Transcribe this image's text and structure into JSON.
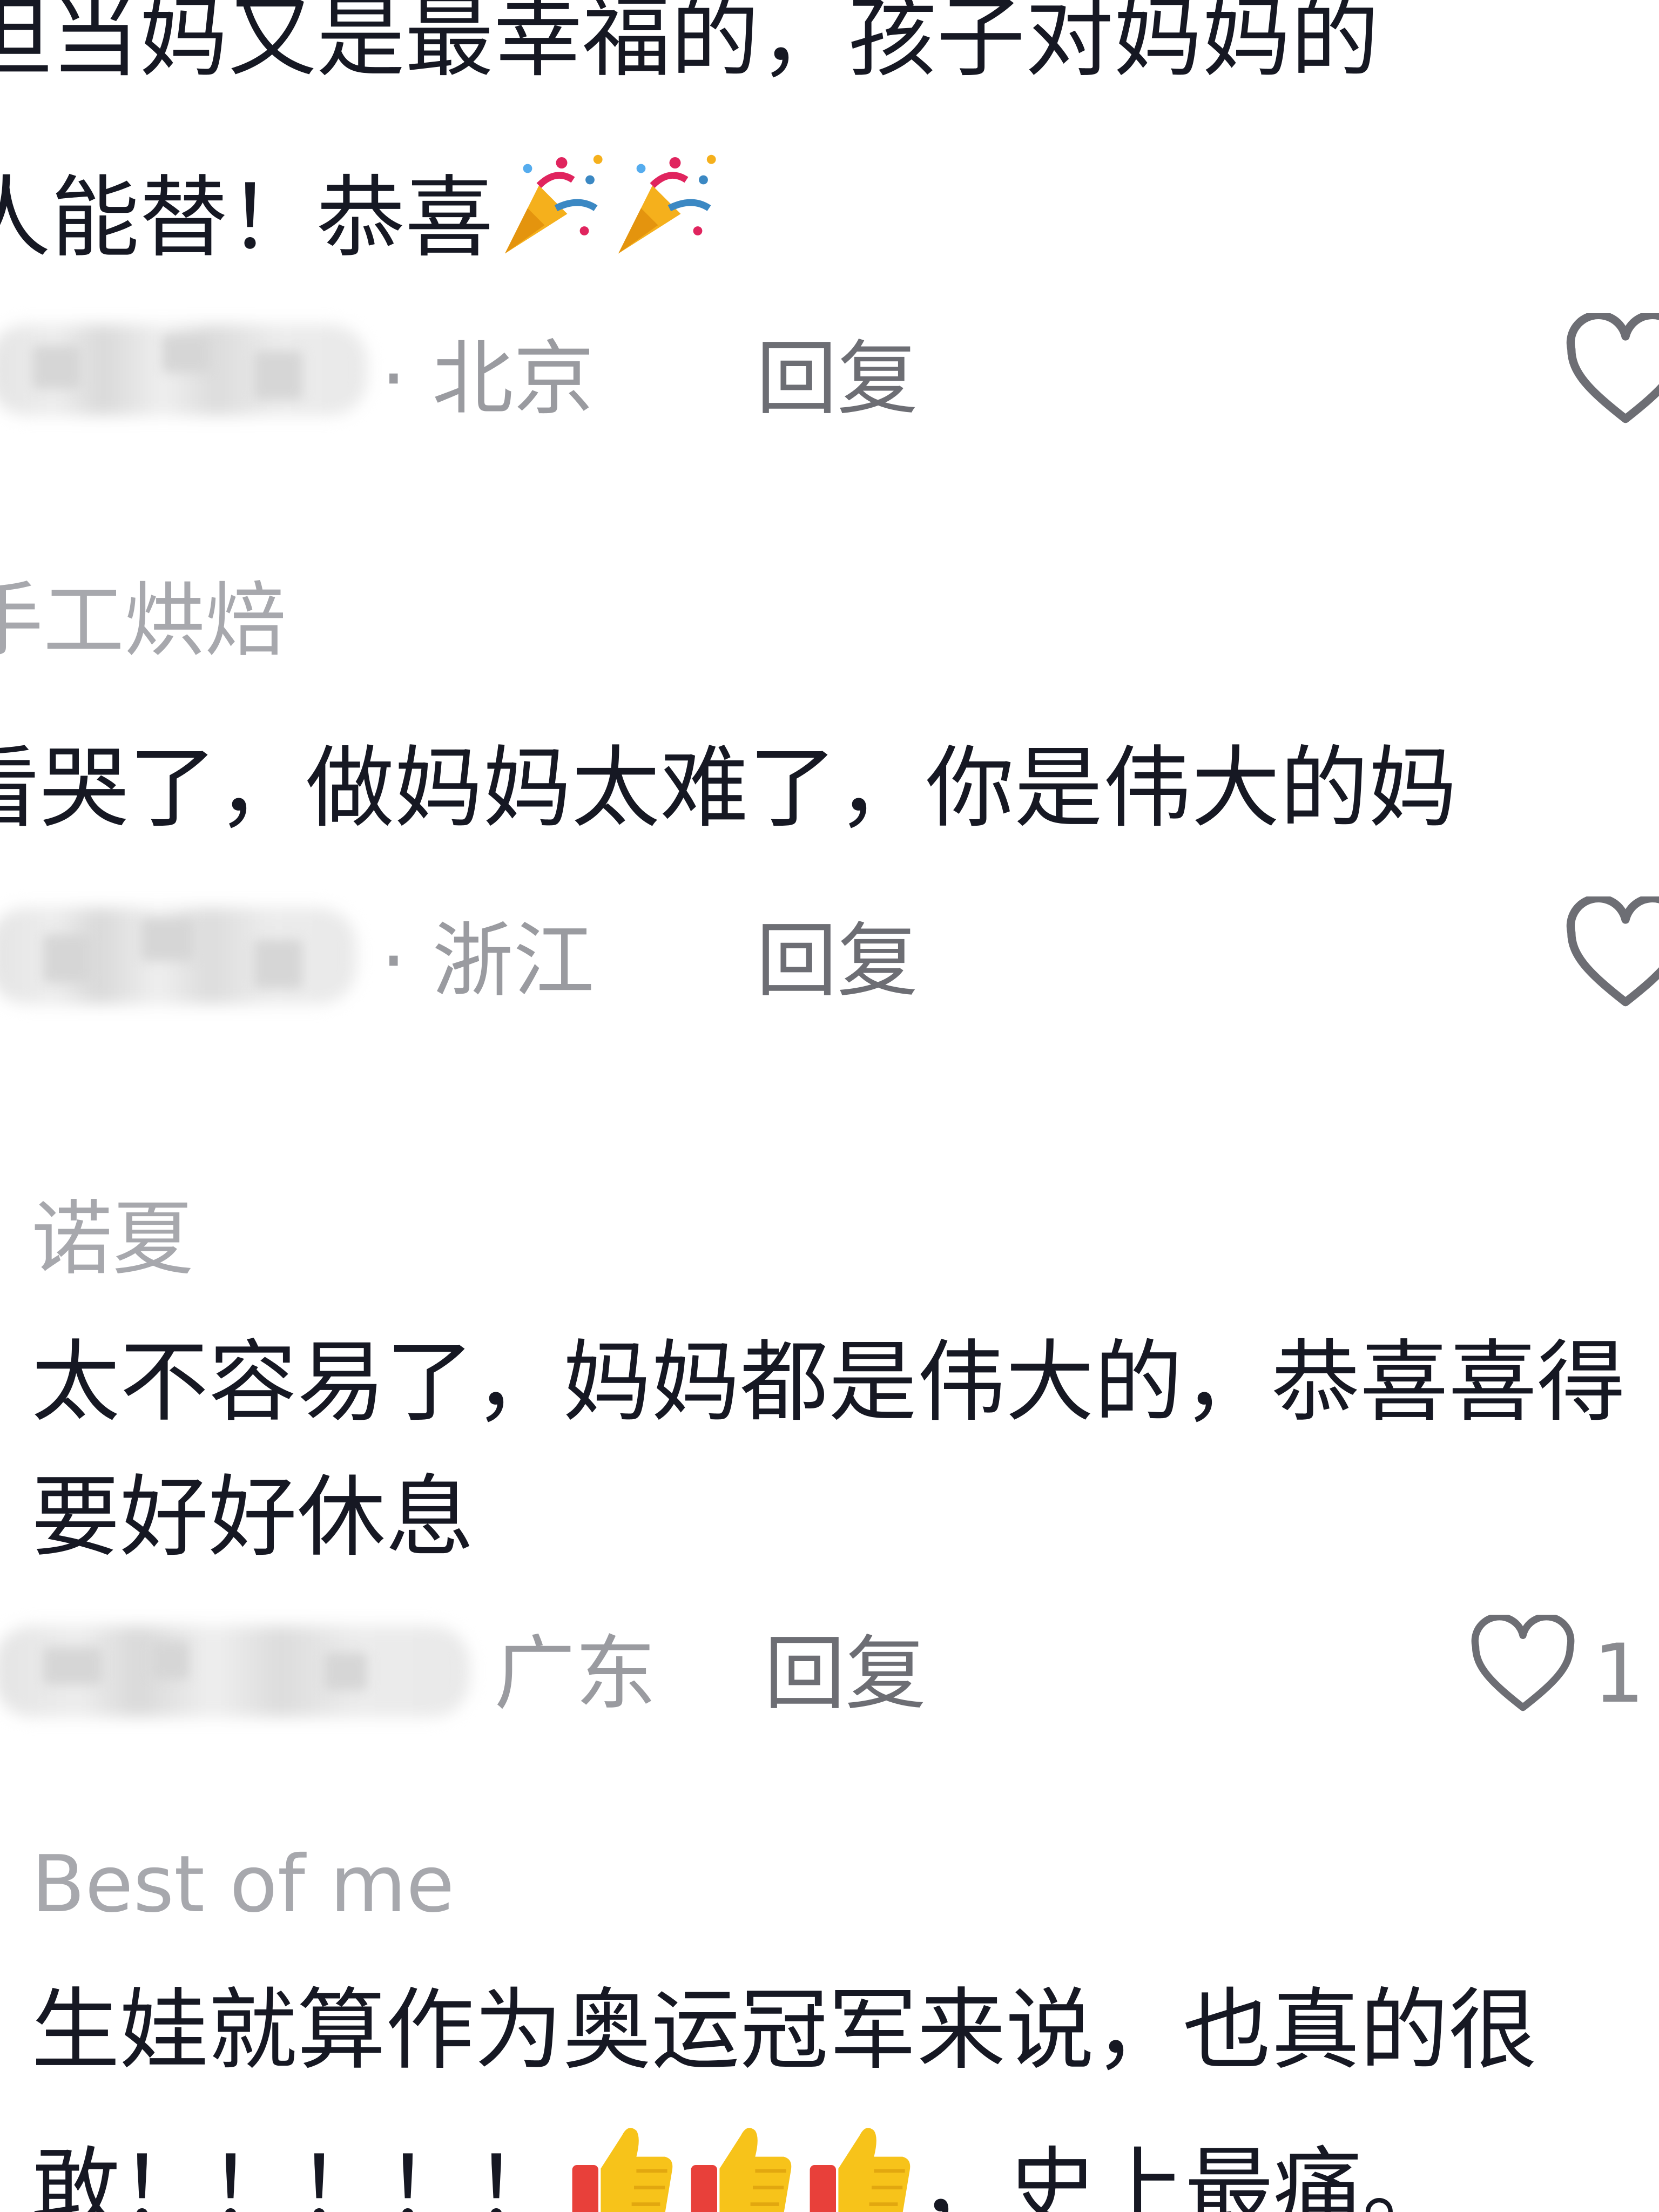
{
  "comments": [
    {
      "username": "",
      "lines": [
        "但当妈又是最幸福的，孩子对妈妈的",
        "人能替！恭喜"
      ],
      "emojis": [
        "party-popper",
        "party-popper"
      ],
      "location": "· 北京",
      "reply_label": "回复",
      "like_count": ""
    },
    {
      "username": "手工烘焙",
      "lines": [
        "看哭了，做妈妈太难了，你是伟大的妈"
      ],
      "location": "· 浙江",
      "reply_label": "回复",
      "like_count": ""
    },
    {
      "username": "诺夏",
      "lines": [
        "太不容易了，妈妈都是伟大的，恭喜喜得",
        "要好好休息"
      ],
      "location": "广东",
      "reply_label": "回复",
      "like_count": "1"
    },
    {
      "username": "Best of me",
      "lines": [
        "生娃就算作为奥运冠军来说，也真的很",
        "敢！！！！！"
      ],
      "line2_tail": "，史上最痛。",
      "emojis": [
        "thumbs-up",
        "thumbs-up",
        "thumbs-up"
      ],
      "location": "",
      "reply_label": "",
      "like_count": ""
    }
  ],
  "colors": {
    "body_text": "#161823",
    "username": "#a7a8ad",
    "meta": "#9a9ba0",
    "reply": "#6d6e74",
    "heart_outline": "#6d6e74"
  }
}
